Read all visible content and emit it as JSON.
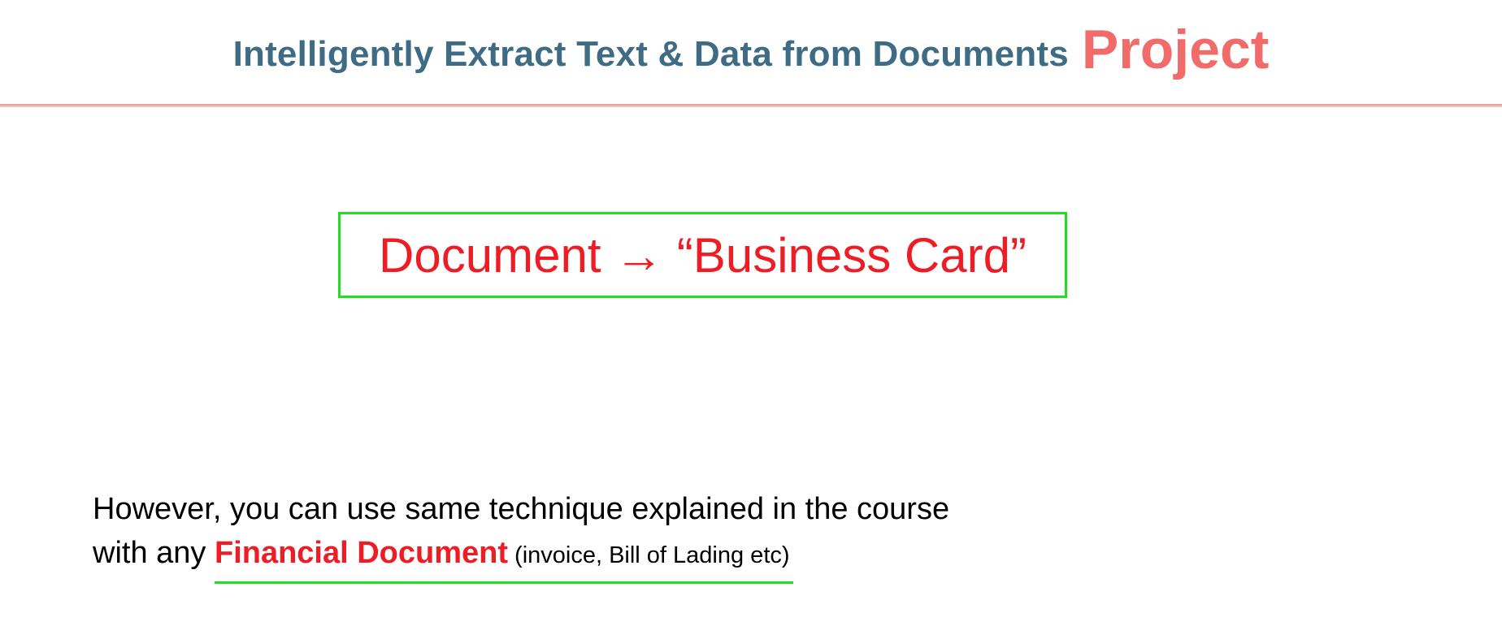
{
  "header": {
    "title_main": "Intelligently Extract Text & Data from Documents",
    "title_accent": "Project"
  },
  "callout": {
    "text": "Document → “Business Card”"
  },
  "body": {
    "line1": "However, you can use same technique explained in the course",
    "line2_prefix": "with any ",
    "highlight": "Financial Document",
    "highlight_note": "(invoice, Bill of Lading etc)"
  },
  "colors": {
    "title_main": "#3f6c85",
    "title_accent": "#f26b6b",
    "callout_text": "#ee1c24",
    "callout_border": "#22dd22",
    "highlight_underline": "#22dd22"
  }
}
